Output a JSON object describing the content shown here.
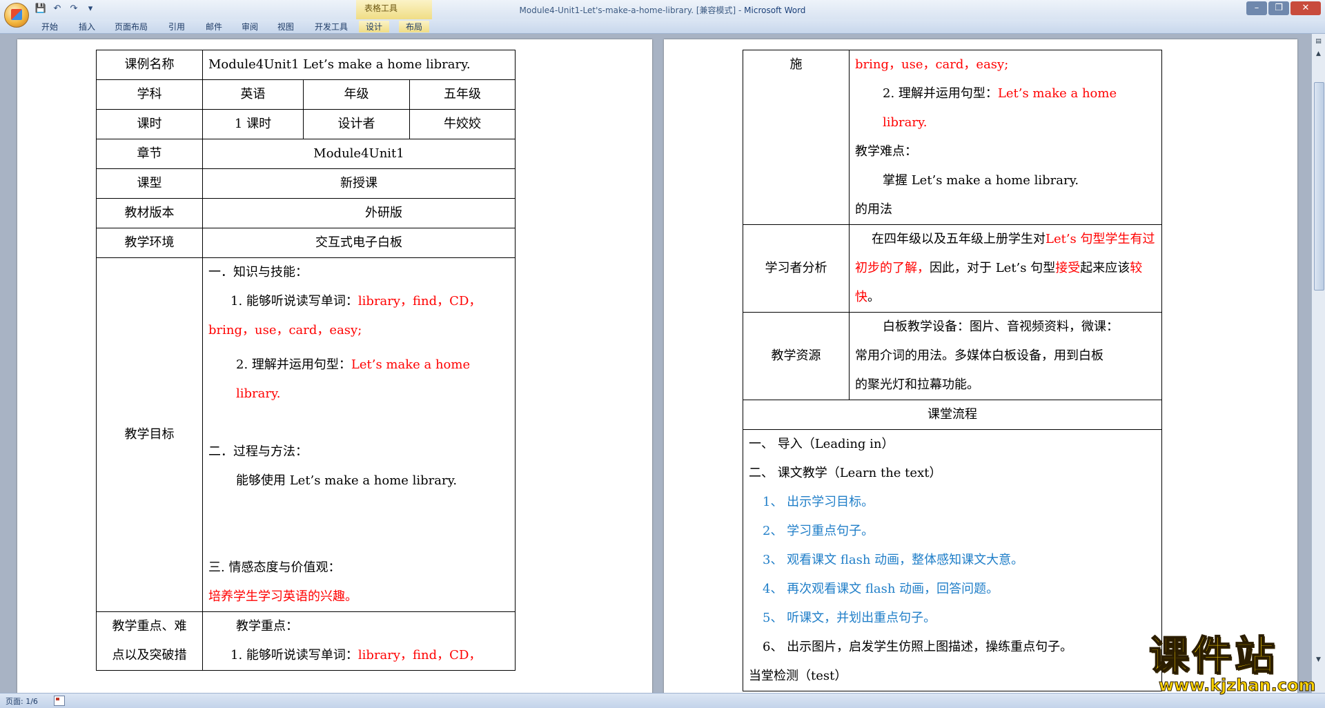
{
  "window": {
    "title_doc": "Module4-Unit1-Let's-make-a-home-library. [兼容模式]",
    "title_sep": " - ",
    "title_app": "Microsoft Word",
    "context_group": "表格工具"
  },
  "qat": [
    "💾",
    "↶",
    "↷",
    "▾"
  ],
  "tabs": [
    "开始",
    "插入",
    "页面布局",
    "引用",
    "邮件",
    "审阅",
    "视图",
    "开发工具",
    "设计",
    "布局"
  ],
  "status": {
    "page": "页面: 1/6"
  },
  "watermark": {
    "text": "课件站",
    "url": "www.kjzhan.com"
  },
  "left_table": {
    "r1": {
      "label": "课例名称",
      "value": "Module4Unit1 Let’s make a home library."
    },
    "r2": {
      "label": "学科",
      "subject": "英语",
      "grade_label": "年级",
      "grade": "五年级"
    },
    "r3": {
      "label": "课时",
      "hours": "1 课时",
      "designer_label": "设计者",
      "designer": "牛姣姣"
    },
    "r4": {
      "label": "章节",
      "value": "Module4Unit1"
    },
    "r5": {
      "label": "课型",
      "value": "新授课"
    },
    "r6": {
      "label": "教材版本",
      "value": "外研版"
    },
    "r7": {
      "label": "教学环境",
      "value": "交互式电子白板"
    },
    "goals": {
      "label": "教学目标",
      "s1_title": "一．知识与技能：",
      "s1_item1_prefix": "1. 能够听说读写单词：",
      "s1_item1_words": "library，find，CD，",
      "s1_item1_words2": "bring，use，card，easy;",
      "s1_item2_prefix": "2. 理解并运用句型：",
      "s1_item2_words": "Let’s make a home",
      "s1_item2_words2": "library.",
      "s2_title": "二．过程与方法：",
      "s2_item": "能够使用 Let’s make a home library.",
      "s3_title": "三. 情感态度与价值观：",
      "s3_item": "培养学生学习英语的兴趣。"
    },
    "key": {
      "label_line1": "教学重点、难",
      "label_line2": "点以及突破措",
      "title": "教学重点：",
      "item1_prefix": "1. 能够听说读写单词：",
      "item1_words": "library，find，CD，"
    }
  },
  "right_table": {
    "cont": {
      "label": "施",
      "line1": "bring，use，card，easy;",
      "item2_prefix": "2. 理解并运用句型：",
      "item2_words": "Let’s make a home",
      "item2_words2": "library.",
      "diff_title": "教学难点：",
      "diff_item": "掌握 Let’s make a home library.",
      "diff_item2": "的用法"
    },
    "learner": {
      "label": "学习者分析",
      "p_a": "在四年级以及五年级上册学生对",
      "p_b": "Let’s 句型",
      "p_c": "学生有过初步的了解，",
      "p_d": "因此，对于 Let’s 句型",
      "p_e": "接受",
      "p_f": "起来应该",
      "p_g": "较快",
      "p_h": "。"
    },
    "resources": {
      "label": "教学资源",
      "line1": "白板教学设备：图片、音视频资料，微课：",
      "line2": "常用介词的用法。多媒体白板设备，用到白板",
      "line3": "的聚光灯和拉幕功能。"
    },
    "flow": {
      "header": "课堂流程",
      "step1": "一、 导入（Leading in）",
      "step2": "二、 课文教学（Learn the text）",
      "sub1": "1、 出示学习目标。",
      "sub2": "2、 学习重点句子。",
      "sub3": "3、 观看课文 flash 动画，整体感知课文大意。",
      "sub4": "4、 再次观看课文 flash 动画，回答问题。",
      "sub5": "5、 听课文，并划出重点句子。",
      "sub6": "6、 出示图片，启发学生仿照上图描述，操练重点句子。",
      "step3": "当堂检测（test）"
    }
  }
}
